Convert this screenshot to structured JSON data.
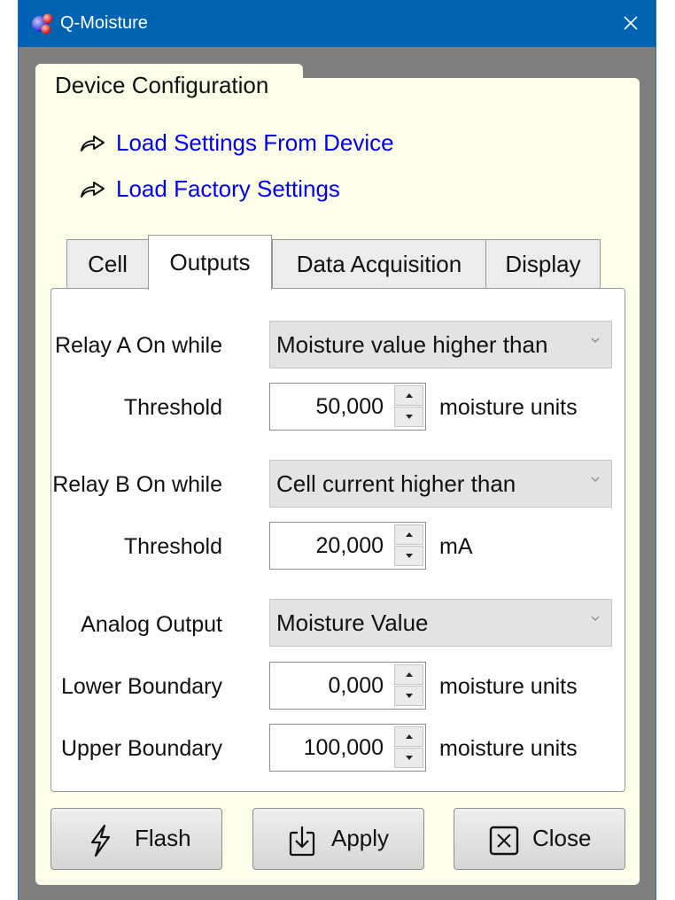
{
  "window": {
    "title": "Q-Moisture",
    "app_icon": "molecule-icon",
    "close_icon": "close-icon"
  },
  "group": {
    "title": "Device Configuration"
  },
  "links": [
    {
      "label": "Load Settings From Device",
      "icon": "share-arrow-icon"
    },
    {
      "label": "Load Factory Settings",
      "icon": "share-arrow-icon"
    }
  ],
  "tabs": [
    {
      "label": "Cell",
      "active": false
    },
    {
      "label": "Outputs",
      "active": true
    },
    {
      "label": "Data Acquisition",
      "active": false
    },
    {
      "label": "Display",
      "active": false
    }
  ],
  "outputs": {
    "relay_a": {
      "label": "Relay A On while",
      "selected": "Moisture value higher than"
    },
    "relay_a_threshold": {
      "label": "Threshold",
      "value": "50,000",
      "unit": "moisture units"
    },
    "relay_b": {
      "label": "Relay B On while",
      "selected": "Cell current higher than"
    },
    "relay_b_threshold": {
      "label": "Threshold",
      "value": "20,000",
      "unit": "mA"
    },
    "analog_output": {
      "label": "Analog Output",
      "selected": "Moisture Value"
    },
    "lower_boundary": {
      "label": "Lower Boundary",
      "value": "0,000",
      "unit": "moisture units"
    },
    "upper_boundary": {
      "label": "Upper Boundary",
      "value": "100,000",
      "unit": "moisture units"
    }
  },
  "buttons": {
    "flash": {
      "label": "Flash",
      "icon": "lightning-icon"
    },
    "apply": {
      "label": "Apply",
      "icon": "download-tray-icon"
    },
    "close": {
      "label": "Close",
      "icon": "close-box-icon"
    }
  },
  "colors": {
    "titlebar": "#0063b1",
    "link": "#0000ee",
    "group_bg": "#fdfee9",
    "frame": "#7f7f7f"
  }
}
